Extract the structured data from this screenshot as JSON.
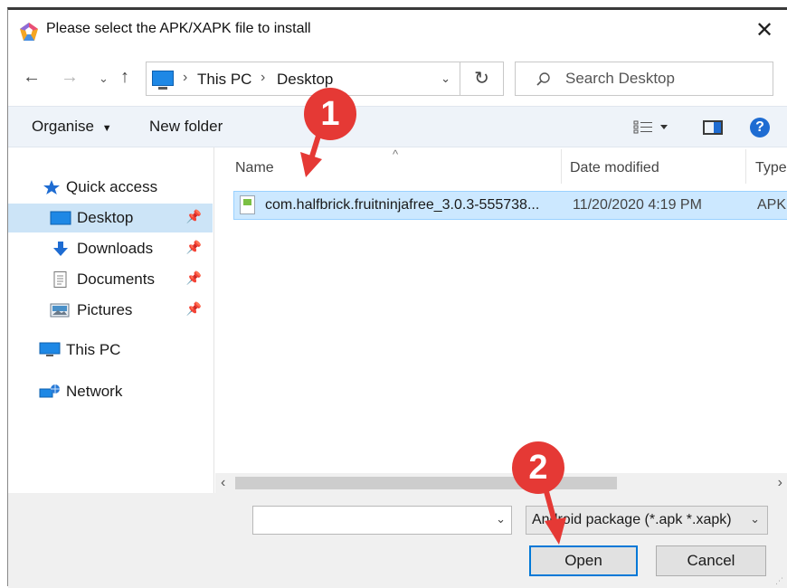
{
  "window": {
    "title": "Please select the APK/XAPK file to install"
  },
  "address": {
    "crumbs": [
      "This PC",
      "Desktop"
    ]
  },
  "search": {
    "placeholder": "Search Desktop"
  },
  "toolbar": {
    "organise": "Organise",
    "new_folder": "New folder",
    "help": "?"
  },
  "sidebar": {
    "items": [
      {
        "label": "Quick access",
        "icon": "star-icon"
      },
      {
        "label": "Desktop",
        "icon": "desktop-icon",
        "pinned": true,
        "selected": true
      },
      {
        "label": "Downloads",
        "icon": "download-icon",
        "pinned": true
      },
      {
        "label": "Documents",
        "icon": "documents-icon",
        "pinned": true
      },
      {
        "label": "Pictures",
        "icon": "pictures-icon",
        "pinned": true
      },
      {
        "label": "This PC",
        "icon": "computer-icon"
      },
      {
        "label": "Network",
        "icon": "network-icon"
      }
    ]
  },
  "columns": {
    "name": "Name",
    "date": "Date modified",
    "type": "Type"
  },
  "files": [
    {
      "name": "com.halfbrick.fruitninjafree_3.0.3-555738...",
      "date": "11/20/2020 4:19 PM",
      "type": "APK"
    }
  ],
  "bottom": {
    "filename_value": "",
    "filter": "Android package (*.apk *.xapk)",
    "open": "Open",
    "cancel": "Cancel"
  },
  "annotations": {
    "step1": "1",
    "step2": "2"
  },
  "colors": {
    "accent": "#0078d7",
    "selection": "#cce8ff",
    "badge": "#e53935"
  }
}
